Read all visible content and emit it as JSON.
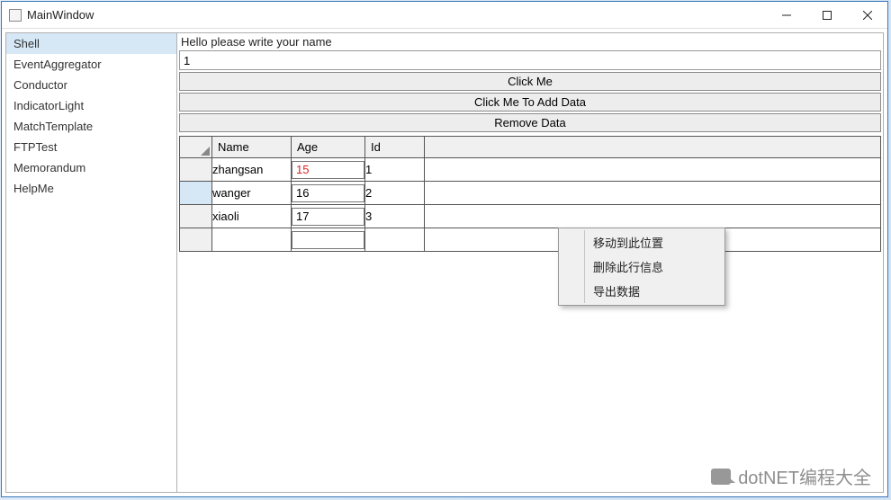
{
  "window": {
    "title": "MainWindow"
  },
  "sidebar": {
    "items": [
      {
        "label": "Shell",
        "selected": true
      },
      {
        "label": "EventAggregator",
        "selected": false
      },
      {
        "label": "Conductor",
        "selected": false
      },
      {
        "label": "IndicatorLight",
        "selected": false
      },
      {
        "label": "MatchTemplate",
        "selected": false
      },
      {
        "label": "FTPTest",
        "selected": false
      },
      {
        "label": "Memorandum",
        "selected": false
      },
      {
        "label": "HelpMe",
        "selected": false
      }
    ]
  },
  "main": {
    "prompt": "Hello please write your name",
    "name_value": "1",
    "buttons": {
      "click_me": "Click Me",
      "add_data": "Click Me To Add Data",
      "remove_data": "Remove Data"
    },
    "grid": {
      "columns": {
        "name": "Name",
        "age": "Age",
        "id": "Id"
      },
      "rows": [
        {
          "name": "zhangsan",
          "age": "15",
          "id": "1",
          "age_red": true,
          "selected": false
        },
        {
          "name": "wanger",
          "age": "16",
          "id": "2",
          "age_red": false,
          "selected": true
        },
        {
          "name": "xiaoli",
          "age": "17",
          "id": "3",
          "age_red": false,
          "selected": false
        }
      ]
    }
  },
  "context_menu": {
    "items": [
      {
        "label": "移动到此位置"
      },
      {
        "label": "删除此行信息"
      },
      {
        "label": "导出数据"
      }
    ]
  },
  "watermark": "dotNET编程大全"
}
